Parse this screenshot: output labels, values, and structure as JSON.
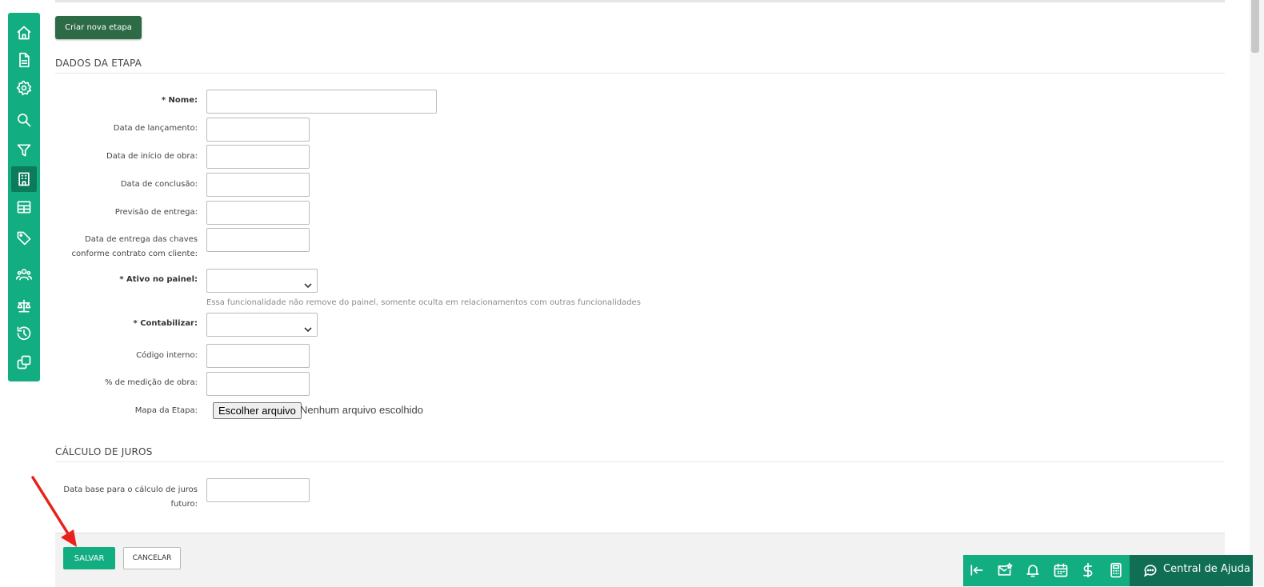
{
  "actions": {
    "create_stage": "Criar nova etapa"
  },
  "sections": {
    "stage_data": "DADOS DA ETAPA",
    "interest_calc": "CÁLCULO DE JUROS"
  },
  "fields": {
    "name": {
      "label": "* Nome:",
      "value": ""
    },
    "launch_date": {
      "label": "Data de lançamento:",
      "value": ""
    },
    "construction_start": {
      "label": "Data de início de obra:",
      "value": ""
    },
    "completion_date": {
      "label": "Data de conclusão:",
      "value": ""
    },
    "delivery_forecast": {
      "label": "Previsão de entrega:",
      "value": ""
    },
    "keys_delivery_line1": "Data de entrega das chaves",
    "keys_delivery_line2": "conforme contrato com cliente:",
    "active_panel": {
      "label": "* Ativo no painel:",
      "value": ""
    },
    "active_panel_help": "Essa funcionalidade não remove do painel, somente oculta em relacionamentos com outras funcionalidades",
    "accounting": {
      "label": "* Contabilizar:",
      "value": ""
    },
    "internal_code": {
      "label": "Código interno:",
      "value": ""
    },
    "work_measurement": {
      "label": "% de medição de obra:",
      "value": ""
    },
    "stage_map": {
      "label": "Mapa da Etapa:",
      "button": "Escolher arquivo",
      "status": "Nenhum arquivo escolhido"
    },
    "interest_base_line1": "Data base para o cálculo de juros",
    "interest_base_line2": "futuro:"
  },
  "footer": {
    "save": "SALVAR",
    "cancel": "CANCELAR"
  },
  "help_center": {
    "label": "Central de Ajuda"
  },
  "sidebar": {
    "items": [
      {
        "icon": "home-icon"
      },
      {
        "icon": "document-icon"
      },
      {
        "icon": "gear-icon"
      },
      {
        "icon": "search-icon"
      },
      {
        "icon": "filter-icon"
      },
      {
        "icon": "building-icon"
      },
      {
        "icon": "table-icon"
      },
      {
        "icon": "tag-icon"
      },
      {
        "icon": "users-icon"
      },
      {
        "icon": "scale-icon"
      },
      {
        "icon": "history-icon"
      },
      {
        "icon": "copy-icon"
      }
    ]
  },
  "colors": {
    "primary": "#13ad82",
    "dark_green": "#2d6b46",
    "help_bg": "#0f6e53",
    "arrow": "#e8221b"
  }
}
